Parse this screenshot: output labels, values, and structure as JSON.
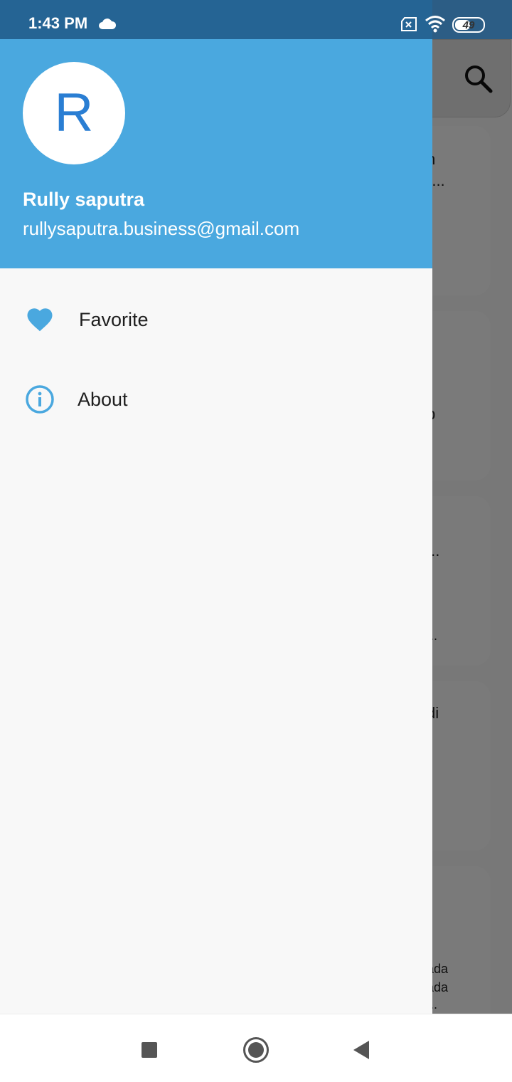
{
  "status_bar": {
    "time": "1:43 PM",
    "battery": "49",
    "icons": [
      "cloud-icon",
      "no-sim-icon",
      "wifi-icon",
      "battery-icon"
    ]
  },
  "background_cards": [
    {
      "lines": [
        "n",
        "-..."
      ]
    },
    {
      "lines": [
        "p"
      ]
    },
    {
      "lines": [
        "...",
        "..."
      ]
    },
    {
      "lines": [
        "di"
      ]
    },
    {
      "lines": [
        "i",
        "ada",
        "ada",
        "..."
      ]
    }
  ],
  "drawer": {
    "avatar_letter": "R",
    "user_name": "Rully saputra",
    "user_email": "rullysaputra.business@gmail.com",
    "items": [
      {
        "label": "Favorite",
        "icon": "heart-icon"
      },
      {
        "label": "About",
        "icon": "info-icon"
      }
    ]
  },
  "colors": {
    "header": "#4aa8df",
    "icon_accent": "#4aa8df",
    "avatar_letter": "#2a7ed3",
    "status_bar": "#1f5887"
  },
  "nav_bar": {
    "icons": [
      "recents-square-icon",
      "home-circle-icon",
      "back-triangle-icon"
    ]
  }
}
